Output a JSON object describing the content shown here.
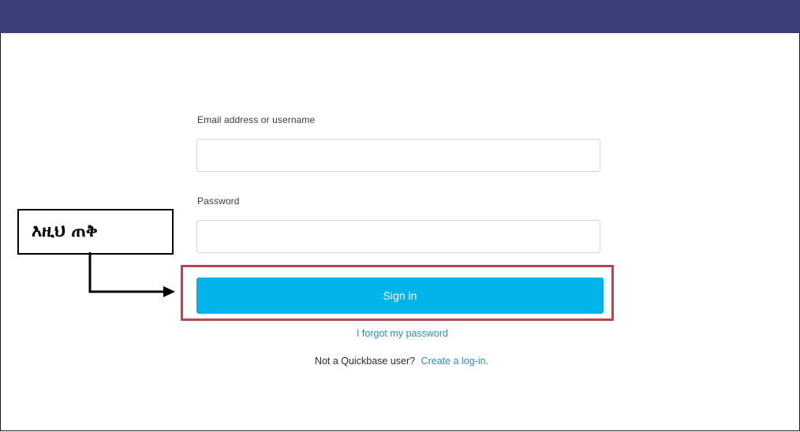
{
  "header": {
    "bar_color": "#3b3f78"
  },
  "form": {
    "email_label": "Email address or username",
    "email_value": "",
    "password_label": "Password",
    "password_value": "",
    "signin_label": "Sign in",
    "signin_color": "#00b3e8",
    "forgot_label": "I forgot my password",
    "not_user_prompt": "Not a Quickbase user?",
    "create_login_label": "Create a log-in."
  },
  "annotation": {
    "callout_text": "እዚህ ጠቅ",
    "highlight_color": "#b5484b",
    "arrow_icon": "right-arrow-icon"
  }
}
